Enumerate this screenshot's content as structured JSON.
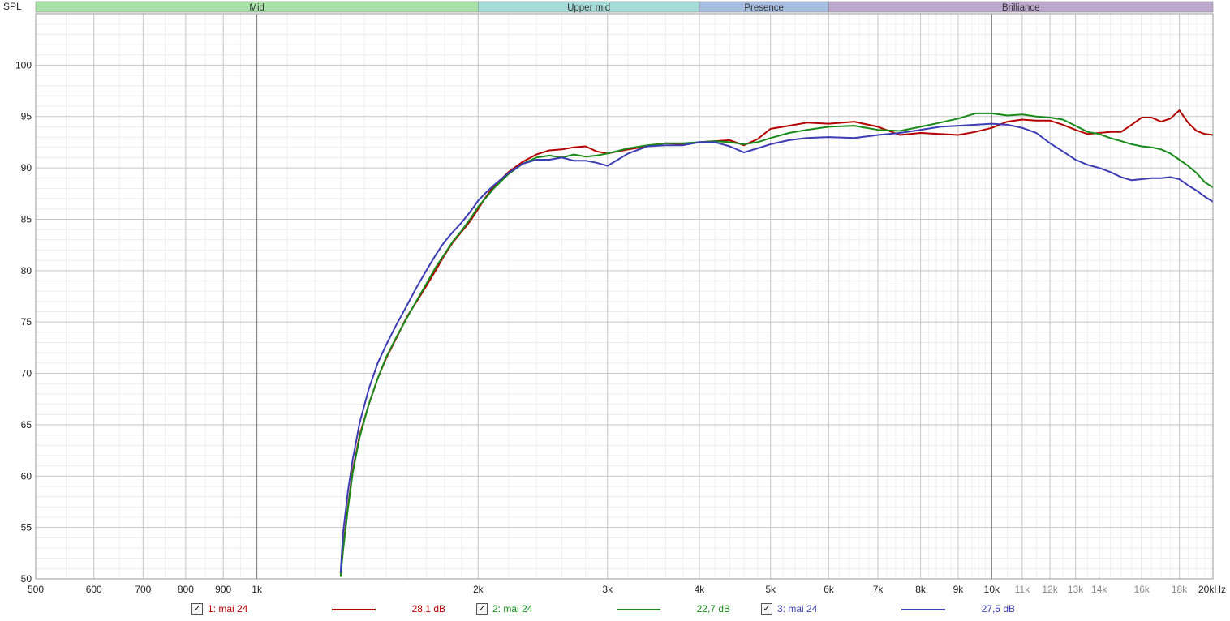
{
  "chart_data": {
    "type": "line",
    "ylabel": "SPL",
    "xunit": "kHz",
    "xscale": "log",
    "xlim": [
      500,
      20000
    ],
    "ylim": [
      50,
      105
    ],
    "grid": true,
    "y_ticks": [
      50,
      55,
      60,
      65,
      70,
      75,
      80,
      85,
      90,
      95,
      100
    ],
    "x_ticks": [
      {
        "value": 500,
        "label": "500"
      },
      {
        "value": 600,
        "label": "600"
      },
      {
        "value": 700,
        "label": "700"
      },
      {
        "value": 800,
        "label": "800"
      },
      {
        "value": 900,
        "label": "900"
      },
      {
        "value": 1000,
        "label": "1k"
      },
      {
        "value": 2000,
        "label": "2k"
      },
      {
        "value": 3000,
        "label": "3k"
      },
      {
        "value": 4000,
        "label": "4k"
      },
      {
        "value": 5000,
        "label": "5k"
      },
      {
        "value": 6000,
        "label": "6k"
      },
      {
        "value": 7000,
        "label": "7k"
      },
      {
        "value": 8000,
        "label": "8k"
      },
      {
        "value": 9000,
        "label": "9k"
      },
      {
        "value": 10000,
        "label": "10k"
      },
      {
        "value": 11000,
        "label": "11k"
      },
      {
        "value": 12000,
        "label": "12k"
      },
      {
        "value": 13000,
        "label": "13k"
      },
      {
        "value": 14000,
        "label": "14k"
      },
      {
        "value": 16000,
        "label": "16k"
      },
      {
        "value": 18000,
        "label": "18k"
      },
      {
        "value": 20000,
        "label": "20kHz"
      }
    ],
    "bands": [
      {
        "name": "Mid",
        "from": 500,
        "to": 2000,
        "color": "#a8e2a8"
      },
      {
        "name": "Upper mid",
        "from": 2000,
        "to": 4000,
        "color": "#a6dcd8"
      },
      {
        "name": "Presence",
        "from": 4000,
        "to": 6000,
        "color": "#a6bde0"
      },
      {
        "name": "Brilliance",
        "from": 6000,
        "to": 20000,
        "color": "#bba8cc"
      }
    ],
    "series": [
      {
        "name": "1: mai 24",
        "color": "#b40000",
        "smoothing_value": "28,1 dB",
        "x": [
          1300,
          1310,
          1330,
          1350,
          1380,
          1420,
          1460,
          1500,
          1550,
          1600,
          1650,
          1700,
          1750,
          1800,
          1850,
          1900,
          1950,
          2000,
          2050,
          2100,
          2200,
          2300,
          2400,
          2500,
          2600,
          2700,
          2800,
          2900,
          3000,
          3200,
          3400,
          3600,
          3800,
          4000,
          4200,
          4400,
          4600,
          4800,
          5000,
          5300,
          5600,
          6000,
          6500,
          7000,
          7500,
          8000,
          8500,
          9000,
          9500,
          10000,
          10500,
          11000,
          11500,
          12000,
          12500,
          13000,
          13500,
          14000,
          14500,
          15000,
          15500,
          16000,
          16500,
          17000,
          17500,
          18000,
          18500,
          19000,
          19500,
          20000
        ],
        "y": [
          50.5,
          53,
          57,
          60.5,
          64,
          67,
          69.5,
          71.5,
          73.5,
          75.5,
          77,
          78.5,
          80,
          81.5,
          82.8,
          83.8,
          84.8,
          86,
          87.2,
          88.2,
          89.6,
          90.6,
          91.3,
          91.7,
          91.8,
          92,
          92.1,
          91.6,
          91.4,
          91.8,
          92.1,
          92.4,
          92.3,
          92.5,
          92.6,
          92.7,
          92.2,
          92.8,
          93.8,
          94.1,
          94.4,
          94.3,
          94.5,
          94,
          93.2,
          93.4,
          93.3,
          93.2,
          93.5,
          93.9,
          94.5,
          94.7,
          94.6,
          94.6,
          94.2,
          93.7,
          93.3,
          93.4,
          93.5,
          93.5,
          94.2,
          94.9,
          94.9,
          94.5,
          94.8,
          95.6,
          94.4,
          93.6,
          93.3,
          93.2
        ]
      },
      {
        "name": "2: mai 24",
        "color": "#198a19",
        "smoothing_value": "22,7 dB",
        "x": [
          1300,
          1310,
          1330,
          1350,
          1380,
          1420,
          1460,
          1500,
          1550,
          1600,
          1650,
          1700,
          1750,
          1800,
          1850,
          1900,
          1950,
          2000,
          2050,
          2100,
          2200,
          2300,
          2400,
          2500,
          2600,
          2700,
          2800,
          2900,
          3000,
          3200,
          3400,
          3600,
          3800,
          4000,
          4200,
          4400,
          4600,
          4800,
          5000,
          5300,
          5600,
          6000,
          6500,
          7000,
          7500,
          8000,
          8500,
          9000,
          9500,
          10000,
          10500,
          11000,
          11500,
          12000,
          12500,
          13000,
          13500,
          14000,
          14500,
          15000,
          15500,
          16000,
          16500,
          17000,
          17500,
          18000,
          18500,
          19000,
          19500,
          20000
        ],
        "y": [
          50.2,
          52.8,
          56.8,
          60.3,
          63.8,
          67,
          69.5,
          71.6,
          73.6,
          75.4,
          77.1,
          78.7,
          80.3,
          81.6,
          82.9,
          83.9,
          85,
          86.2,
          87.1,
          88,
          89.4,
          90.4,
          91,
          91.2,
          91,
          91.3,
          91.1,
          91.2,
          91.4,
          91.9,
          92.2,
          92.4,
          92.4,
          92.5,
          92.6,
          92.5,
          92.3,
          92.5,
          92.9,
          93.4,
          93.7,
          94,
          94.1,
          93.7,
          93.6,
          94,
          94.4,
          94.8,
          95.3,
          95.3,
          95.1,
          95.2,
          95,
          94.9,
          94.7,
          94.1,
          93.5,
          93.3,
          92.9,
          92.6,
          92.3,
          92.1,
          92,
          91.8,
          91.4,
          90.8,
          90.2,
          89.5,
          88.6,
          88.1
        ]
      },
      {
        "name": "3: mai 24",
        "color": "#3c3cb4",
        "smoothing_value": "27,5 dB",
        "x": [
          1300,
          1310,
          1330,
          1350,
          1380,
          1420,
          1460,
          1500,
          1550,
          1600,
          1650,
          1700,
          1750,
          1800,
          1850,
          1900,
          1950,
          2000,
          2050,
          2100,
          2200,
          2300,
          2400,
          2500,
          2600,
          2700,
          2800,
          2900,
          3000,
          3200,
          3400,
          3600,
          3800,
          4000,
          4200,
          4400,
          4600,
          4800,
          5000,
          5300,
          5600,
          6000,
          6500,
          7000,
          7500,
          8000,
          8500,
          9000,
          9500,
          10000,
          10500,
          11000,
          11500,
          12000,
          12500,
          13000,
          13500,
          14000,
          14500,
          15000,
          15500,
          16000,
          16500,
          17000,
          17500,
          18000,
          18500,
          19000,
          19500,
          20000
        ],
        "y": [
          50.6,
          54.5,
          58.5,
          61.6,
          65.2,
          68.5,
          71,
          72.8,
          74.8,
          76.6,
          78.4,
          80,
          81.5,
          82.8,
          83.8,
          84.7,
          85.7,
          86.8,
          87.6,
          88.3,
          89.5,
          90.4,
          90.8,
          90.8,
          91,
          90.7,
          90.7,
          90.5,
          90.2,
          91.4,
          92.1,
          92.2,
          92.2,
          92.5,
          92.5,
          92.1,
          91.5,
          91.9,
          92.3,
          92.7,
          92.9,
          93,
          92.9,
          93.2,
          93.4,
          93.7,
          94,
          94.1,
          94.2,
          94.3,
          94.2,
          93.9,
          93.4,
          92.4,
          91.6,
          90.8,
          90.3,
          90,
          89.6,
          89.1,
          88.8,
          88.9,
          89,
          89,
          89.1,
          88.9,
          88.3,
          87.8,
          87.2,
          86.7
        ]
      }
    ]
  }
}
